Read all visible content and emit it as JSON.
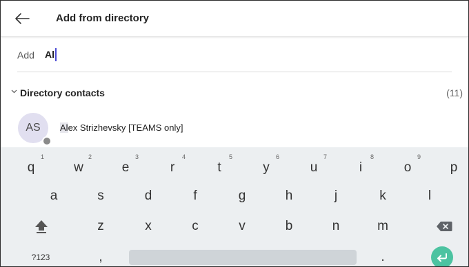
{
  "header": {
    "title": "Add from directory",
    "back_icon": "arrow-left-icon"
  },
  "add": {
    "label": "Add",
    "value": "Al"
  },
  "section": {
    "title": "Directory contacts",
    "count": "(11)",
    "toggle_icon": "chevron-down-icon"
  },
  "contacts": [
    {
      "initials": "AS",
      "name_highlight": "Al",
      "name_rest": "ex Strizhevsky [TEAMS only]",
      "presence_color": "#8a8a8a"
    }
  ],
  "keyboard": {
    "row1": [
      {
        "key": "q",
        "hint": "1"
      },
      {
        "key": "w",
        "hint": "2"
      },
      {
        "key": "e",
        "hint": "3"
      },
      {
        "key": "r",
        "hint": "4"
      },
      {
        "key": "t",
        "hint": "5"
      },
      {
        "key": "y",
        "hint": "6"
      },
      {
        "key": "u",
        "hint": "7"
      },
      {
        "key": "i",
        "hint": "8"
      },
      {
        "key": "o",
        "hint": "9"
      },
      {
        "key": "p",
        "hint": ""
      }
    ],
    "row2": [
      "a",
      "s",
      "d",
      "f",
      "g",
      "h",
      "j",
      "k",
      "l"
    ],
    "row3": [
      "z",
      "x",
      "c",
      "v",
      "b",
      "n",
      "m"
    ],
    "symbols_label": "?123",
    "comma": ",",
    "period": ".",
    "shift_icon": "shift-icon",
    "backspace_icon": "backspace-icon",
    "enter_icon": "enter-icon",
    "enter_color": "#4cc3a1"
  }
}
